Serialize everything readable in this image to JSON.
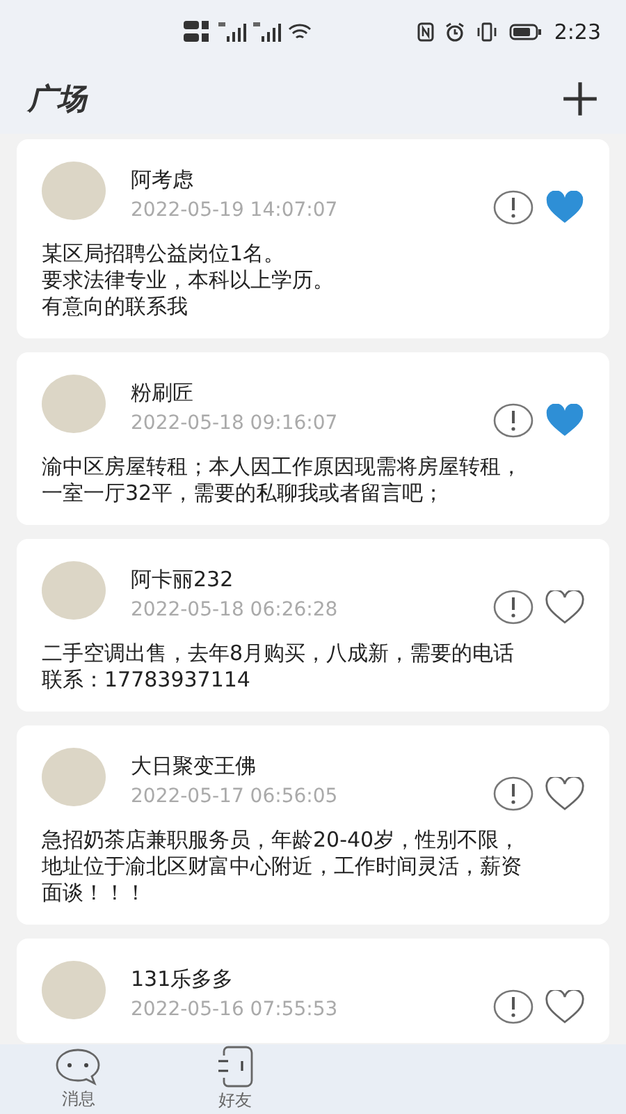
{
  "status_bar": {
    "time": "2:23"
  },
  "header": {
    "title": "广场"
  },
  "posts": [
    {
      "name": "阿考虑",
      "time": "2022-05-19 14:07:07",
      "lines": [
        "某区局招聘公益岗位1名。",
        "要求法律专业，本科以上学历。",
        "有意向的联系我"
      ],
      "liked": true
    },
    {
      "name": "粉刷匠",
      "time": "2022-05-18 09:16:07",
      "lines": [
        "渝中区房屋转租；本人因工作原因现需将房屋转租，",
        "一室一厅32平，需要的私聊我或者留言吧；"
      ],
      "liked": true
    },
    {
      "name": "阿卡丽232",
      "time": "2022-05-18 06:26:28",
      "lines": [
        "二手空调出售，去年8月购买，八成新，需要的电话",
        "联系：17783937114"
      ],
      "liked": false
    },
    {
      "name": "大日聚变王佛",
      "time": "2022-05-17 06:56:05",
      "lines": [
        "急招奶茶店兼职服务员，年龄20-40岁，性别不限，",
        "地址位于渝北区财富中心附近，工作时间灵活，薪资",
        "面谈！！！"
      ],
      "liked": false
    },
    {
      "name": "131乐多多",
      "time": "2022-05-16 07:55:53",
      "liked": false
    }
  ],
  "bottom_nav": [
    {
      "label": "消息",
      "kind": "chat"
    },
    {
      "label": "好友",
      "kind": "friends"
    }
  ]
}
